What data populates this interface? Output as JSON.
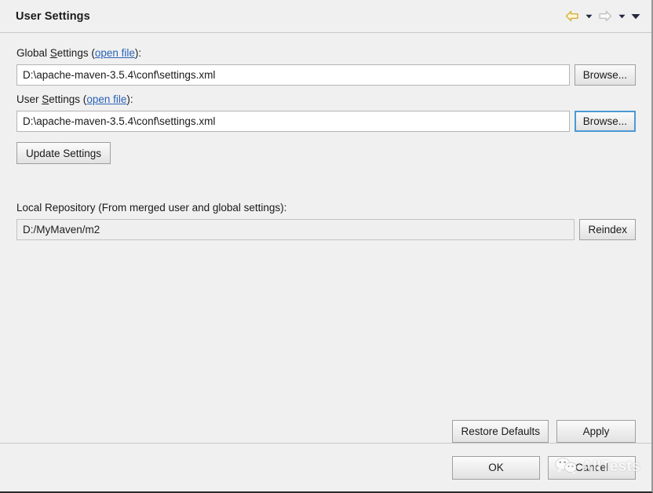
{
  "header": {
    "title": "User Settings",
    "nav": {
      "back_icon": "back-arrow-icon",
      "back_dropdown_icon": "chevron-down-icon",
      "forward_icon": "forward-arrow-icon",
      "forward_dropdown_icon": "chevron-down-icon",
      "menu_icon": "chevron-down-icon"
    },
    "colors": {
      "back_arrow": "#e8c84a",
      "forward_arrow": "#d8d8d8",
      "menu_caret": "#2b2f52"
    }
  },
  "global_settings": {
    "label_prefix": "Global ",
    "label_mnemonic": "S",
    "label_rest": "ettings (",
    "link": "open file",
    "label_suffix": "):",
    "value": "D:\\apache-maven-3.5.4\\conf\\settings.xml",
    "browse_label": "Browse..."
  },
  "user_settings": {
    "label_prefix": "User ",
    "label_mnemonic": "S",
    "label_rest": "ettings (",
    "link": "open file",
    "label_suffix": "):",
    "value": "D:\\apache-maven-3.5.4\\conf\\settings.xml",
    "browse_label": "Browse...",
    "browse_focused": true
  },
  "update_settings": {
    "label": "Update Settings"
  },
  "local_repository": {
    "label": "Local Repository (From merged user and global settings):",
    "value": "D:/MyMaven/m2",
    "reindex_label": "Reindex"
  },
  "actions": {
    "restore_defaults": "Restore Defaults",
    "apply": "Apply",
    "ok": "OK",
    "cancel": "Cancel"
  },
  "watermark": {
    "text": "AllTests",
    "icon": "wechat-logo-icon"
  }
}
